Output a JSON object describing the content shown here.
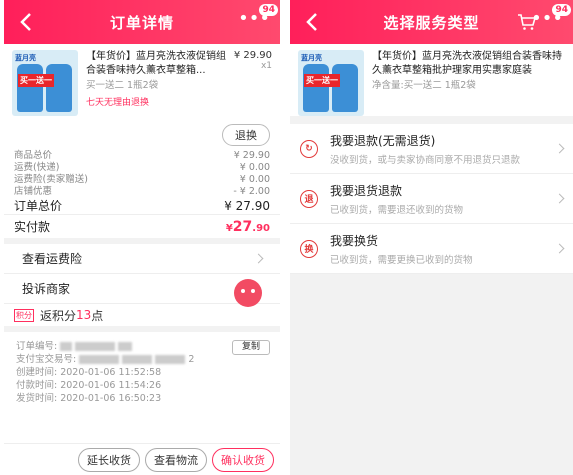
{
  "left": {
    "header": {
      "title": "订单详情",
      "badge": "94"
    },
    "product": {
      "logo": "蓝月亮",
      "promo": "买一送一",
      "name": "【年货价】蓝月亮洗衣液促销组合装香味持久薰衣草整箱...",
      "sku": "买一送二 1瓶2袋",
      "tag": "七天无理由退换",
      "price": "¥ 29.90",
      "qty": "x1"
    },
    "exchange_label": "退换",
    "fees": [
      {
        "label": "商品总价",
        "value": "¥ 29.90"
      },
      {
        "label": "运费(快递)",
        "value": "¥ 0.00"
      },
      {
        "label": "运费险(卖家赠送)",
        "value": "¥ 0.00"
      },
      {
        "label": "店铺优惠",
        "value": "- ¥ 2.00"
      }
    ],
    "order_total": {
      "label": "订单总价",
      "value": "¥ 27.90"
    },
    "paid": {
      "label": "实付款",
      "currency": "¥",
      "int": "27",
      "dec": ".90"
    },
    "cells": {
      "insurance": "查看运费险",
      "complain": "投诉商家"
    },
    "points": {
      "tag": "积分",
      "prefix": "返积分",
      "num": "13",
      "suffix": "点"
    },
    "meta": {
      "order_no": "订单编号:",
      "alipay_no": "支付宝交易号:",
      "alipay_tail": "2",
      "created": "创建时间:  2020-01-06 11:52:58",
      "paid_time": "付款时间:  2020-01-06 11:54:26",
      "shipped": "发货时间:  2020-01-06 16:50:23",
      "copy": "复制"
    },
    "bottom": {
      "extend": "延长收货",
      "logistics": "查看物流",
      "confirm": "确认收货"
    }
  },
  "right": {
    "header": {
      "title": "选择服务类型",
      "badge": "94"
    },
    "product": {
      "name": "【年货价】蓝月亮洗衣液促销组合装香味持久薰衣草整箱批护理家用实惠家庭装",
      "sku": "净含量:买一送二 1瓶2袋"
    },
    "services": [
      {
        "icon": "↻",
        "title": "我要退款(无需退货)",
        "desc": "没收到货，或与卖家协商同意不用退货只退款"
      },
      {
        "icon": "退",
        "title": "我要退货退款",
        "desc": "已收到货，需要退还收到的货物"
      },
      {
        "icon": "换",
        "title": "我要换货",
        "desc": "已收到货，需要更换已收到的货物"
      }
    ]
  },
  "colors": {
    "accent": "#ff2f5e",
    "header_gradient_start": "#ff1f5a",
    "header_gradient_end": "#ff4a6e"
  }
}
